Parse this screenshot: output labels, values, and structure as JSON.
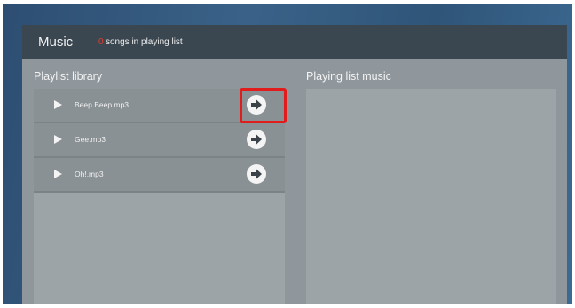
{
  "app": {
    "title": "Music"
  },
  "header": {
    "count_value": "0",
    "count_label": "songs in playing list"
  },
  "library": {
    "title": "Playlist library",
    "songs": [
      {
        "name": "Beep Beep.mp3",
        "action_icon": "arrow-right-icon"
      },
      {
        "name": "Gee.mp3",
        "action_icon": "arrow-right-icon"
      },
      {
        "name": "Oh!.mp3",
        "action_icon": "arrow-right-icon"
      }
    ]
  },
  "playing": {
    "title": "Playing list music",
    "songs": []
  },
  "colors": {
    "highlight": "#e01c1c",
    "header_bg": "#3b4750",
    "accent_count": "#e83a2a"
  }
}
